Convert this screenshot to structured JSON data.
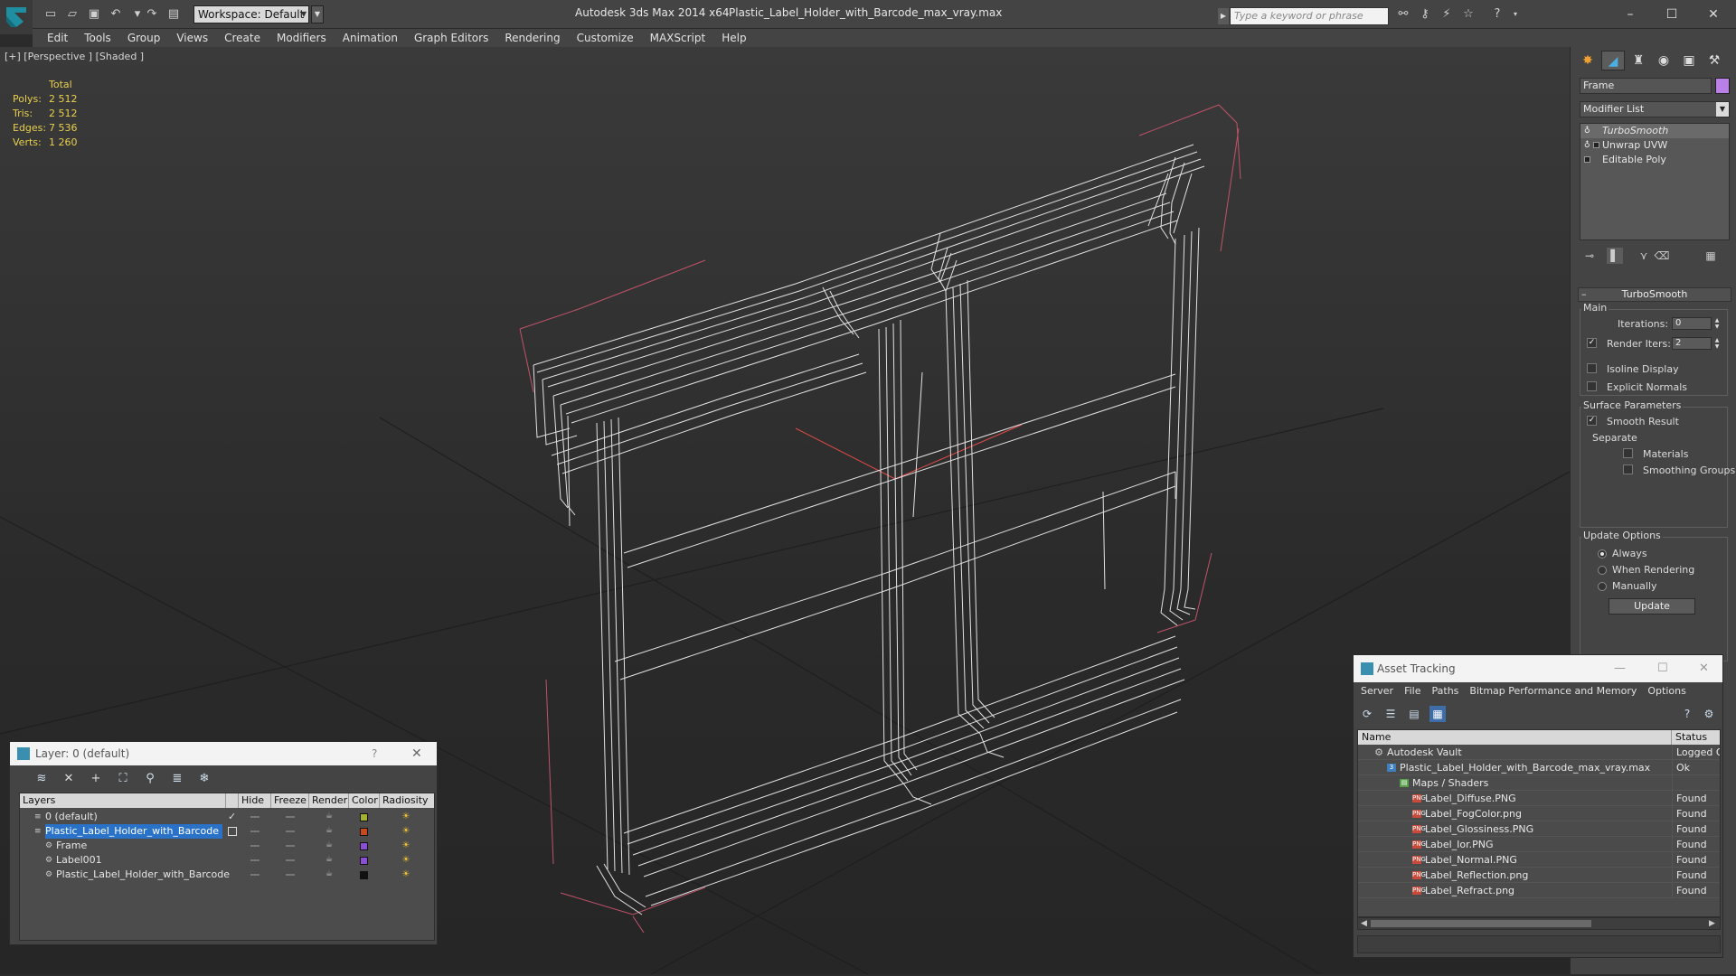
{
  "titlebar": {
    "workspace": "Workspace: Default",
    "app_title": "Autodesk 3ds Max  2014 x64",
    "file_name": "Plastic_Label_Holder_with_Barcode_max_vray.max",
    "search_placeholder": "Type a keyword or phrase"
  },
  "menu": [
    "Edit",
    "Tools",
    "Group",
    "Views",
    "Create",
    "Modifiers",
    "Animation",
    "Graph Editors",
    "Rendering",
    "Customize",
    "MAXScript",
    "Help"
  ],
  "viewport": {
    "label": "[+] [Perspective ] [Shaded ]",
    "stats": {
      "header": "Total",
      "rows": [
        {
          "label": "Polys:",
          "value": "2 512"
        },
        {
          "label": "Tris:",
          "value": "2 512"
        },
        {
          "label": "Edges:",
          "value": "7 536"
        },
        {
          "label": "Verts:",
          "value": "1 260"
        }
      ]
    }
  },
  "command_panel": {
    "object_name": "Frame",
    "object_color": "#b980e6",
    "modifier_list": "Modifier List",
    "stack": [
      "TurboSmooth",
      "Unwrap UVW",
      "Editable Poly"
    ],
    "rollout_title": "TurboSmooth",
    "main_group": "Main",
    "iterations_label": "Iterations:",
    "iterations_value": "0",
    "render_iters_label": "Render Iters:",
    "render_iters_value": "2",
    "render_iters_checked": true,
    "isoline_label": "Isoline Display",
    "explicit_label": "Explicit Normals",
    "surface_group": "Surface Parameters",
    "smooth_result_label": "Smooth Result",
    "smooth_result_checked": true,
    "separate_label": "Separate",
    "materials_label": "Materials",
    "smoothing_groups_label": "Smoothing Groups",
    "update_group": "Update Options",
    "always_label": "Always",
    "when_rendering_label": "When Rendering",
    "manually_label": "Manually",
    "update_button": "Update"
  },
  "layer_dialog": {
    "title": "Layer: 0 (default)",
    "help": "?",
    "columns": [
      "Layers",
      "Hide",
      "Freeze",
      "Render",
      "Color",
      "Radiosity"
    ],
    "rows": [
      {
        "name": "0 (default)",
        "indent": 0,
        "color": "#a5b22d",
        "selected": false,
        "checked": true
      },
      {
        "name": "Plastic_Label_Holder_with_Barcode",
        "indent": 0,
        "color": "#c64a1e",
        "selected": true,
        "checked": false
      },
      {
        "name": "Frame",
        "indent": 1,
        "color": "#8a4fd2",
        "selected": false,
        "checked": false
      },
      {
        "name": "Label001",
        "indent": 1,
        "color": "#8a4fd2",
        "selected": false,
        "checked": false
      },
      {
        "name": "Plastic_Label_Holder_with_Barcode",
        "indent": 1,
        "color": "#111111",
        "selected": false,
        "checked": false
      }
    ]
  },
  "asset_dialog": {
    "title": "Asset Tracking",
    "menu": [
      "Server",
      "File",
      "Paths",
      "Bitmap Performance and Memory",
      "Options"
    ],
    "columns": [
      "Name",
      "Status"
    ],
    "rows": [
      {
        "name": "Autodesk Vault",
        "indent": 1,
        "icon": "vault",
        "status": "Logged Out"
      },
      {
        "name": "Plastic_Label_Holder_with_Barcode_max_vray.max",
        "indent": 2,
        "icon": "max",
        "status": "Ok"
      },
      {
        "name": "Maps / Shaders",
        "indent": 3,
        "icon": "maps",
        "status": ""
      },
      {
        "name": "Label_Diffuse.PNG",
        "indent": 4,
        "icon": "png",
        "status": "Found"
      },
      {
        "name": "Label_FogColor.png",
        "indent": 4,
        "icon": "png",
        "status": "Found"
      },
      {
        "name": "Label_Glossiness.PNG",
        "indent": 4,
        "icon": "png",
        "status": "Found"
      },
      {
        "name": "Label_Ior.PNG",
        "indent": 4,
        "icon": "png",
        "status": "Found"
      },
      {
        "name": "Label_Normal.PNG",
        "indent": 4,
        "icon": "png",
        "status": "Found"
      },
      {
        "name": "Label_Reflection.png",
        "indent": 4,
        "icon": "png",
        "status": "Found"
      },
      {
        "name": "Label_Refract.png",
        "indent": 4,
        "icon": "png",
        "status": "Found"
      }
    ]
  }
}
